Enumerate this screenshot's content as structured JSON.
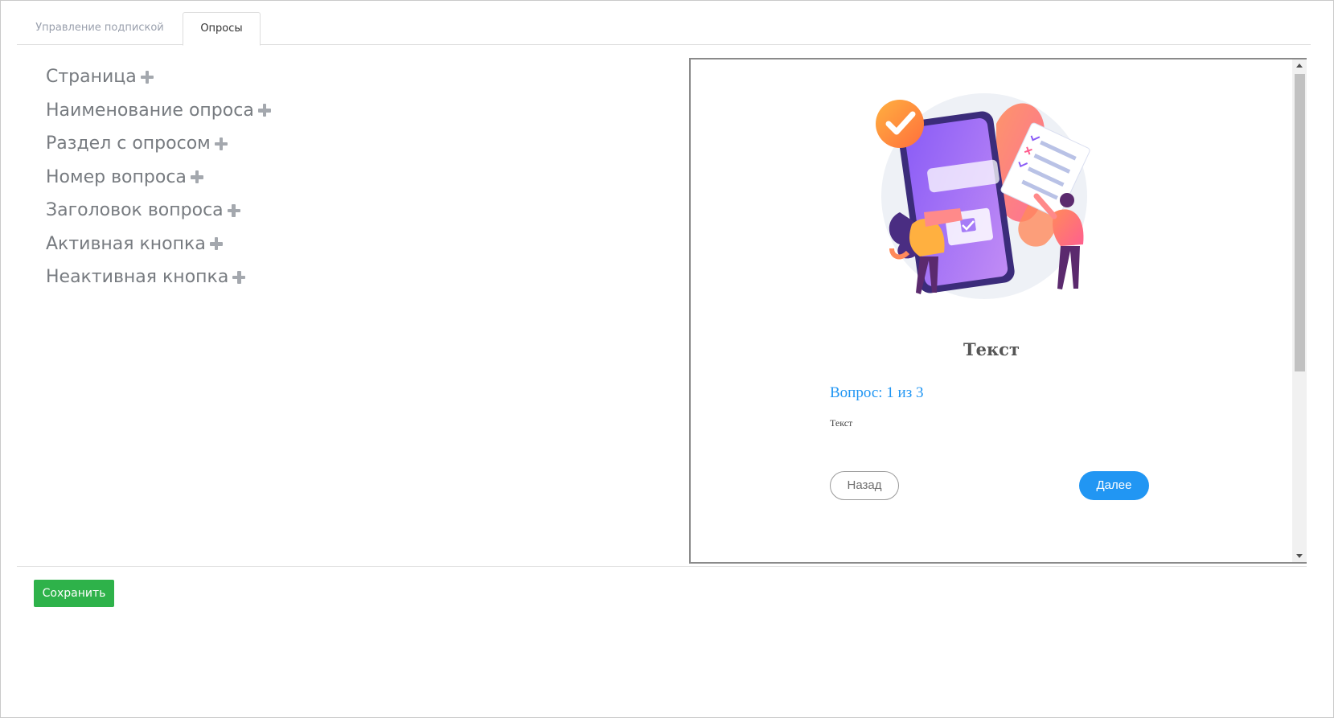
{
  "tabs": [
    {
      "label": "Управление подпиской",
      "active": false
    },
    {
      "label": "Опросы",
      "active": true
    }
  ],
  "style_items": [
    {
      "label": "Страница"
    },
    {
      "label": "Наименование опроса"
    },
    {
      "label": "Раздел с опросом"
    },
    {
      "label": "Номер вопроса"
    },
    {
      "label": "Заголовок вопроса"
    },
    {
      "label": "Активная кнопка"
    },
    {
      "label": "Неактивная кнопка"
    }
  ],
  "preview": {
    "title": "Текст",
    "counter": "Вопрос: 1 из 3",
    "question_text": "Текст",
    "back_label": "Назад",
    "next_label": "Далее",
    "accent_color": "#2196f3"
  },
  "footer": {
    "save_label": "Сохранить",
    "save_color": "#2eb24a"
  }
}
